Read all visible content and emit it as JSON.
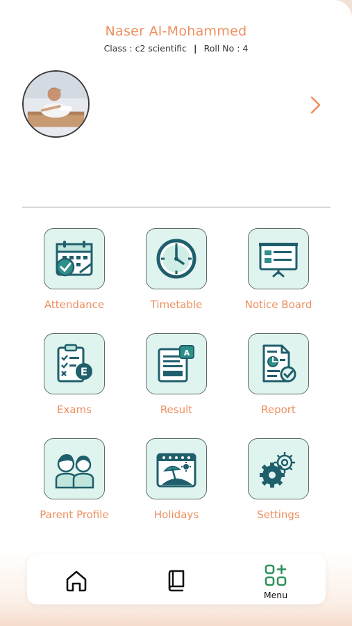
{
  "student": {
    "name": "Naser Al-Mohammed",
    "class_text": "Class : c2 scientific",
    "separator": "|",
    "roll_text": "Roll No : 4"
  },
  "menu": [
    {
      "label": "Attendance",
      "icon": "attendance-calendar-icon"
    },
    {
      "label": "Timetable",
      "icon": "clock-icon"
    },
    {
      "label": "Notice Board",
      "icon": "notice-board-icon"
    },
    {
      "label": "Exams",
      "icon": "exam-checklist-icon"
    },
    {
      "label": "Result",
      "icon": "result-document-icon"
    },
    {
      "label": "Report",
      "icon": "report-document-icon"
    },
    {
      "label": "Parent Profile",
      "icon": "parents-icon"
    },
    {
      "label": "Holidays",
      "icon": "holiday-calendar-icon"
    },
    {
      "label": "Settings",
      "icon": "gears-icon"
    }
  ],
  "bottom_nav": {
    "home_icon": "home-icon",
    "book_icon": "book-icon",
    "menu_icon": "menu-grid-icon",
    "menu_label": "Menu"
  },
  "colors": {
    "accent_orange": "#ee8e5f",
    "tile_bg": "#dff4ee",
    "icon_teal": "#1f5f6c",
    "nav_active_green": "#2f8f5a"
  }
}
